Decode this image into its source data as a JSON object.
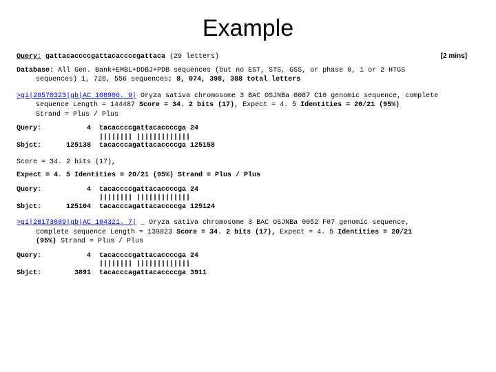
{
  "title": "Example",
  "query": {
    "label": "Query:",
    "seq": "gattacaccccgattacaccccgattaca",
    "len": "(29 letters)",
    "mins": "[2 mins]"
  },
  "database": {
    "label": "Database:",
    "line1": "All Gen. Bank+EMBL+DDBJ+PDB sequences (but no EST, STS, GSS, or phase 0, 1 or 2 HTGS",
    "line2": "sequences) 1, 726, 556 sequences;",
    "total": "8, 074, 398, 388 total letters"
  },
  "hit1": {
    "link": ">gi|28570323|gb|AC 108906. 9|",
    "desc1": "Oryza sativa chromosome 3 BAC OSJNBa 0087 C10 genomic sequence, complete",
    "desc2": "sequence Length = 144487",
    "score": "Score = 34. 2 bits (17),",
    "expect": "Expect = 4. 5",
    "ident": "Identities = 20/21 (95%)",
    "strand": "Strand = Plus / Plus"
  },
  "aln1": {
    "q": "Query:           4  tacaccccgattacaccccga 24",
    "m": "                    |||||||| |||||||||||||",
    "s": "Sbjct:      125138  tacacccagattacaccccga 125158"
  },
  "mid": {
    "score": "Score = 34. 2 bits (17),",
    "line": "Expect = 4. 5 Identities = 20/21 (95%) Strand = Plus / Plus"
  },
  "aln2": {
    "q": "Query:           4  tacaccccgattacaccccga 24",
    "m": "                    |||||||| |||||||||||||",
    "s": "Sbjct:      125104  tacacccagattacaccccga 125124"
  },
  "hit2": {
    "link": ">gi|28173089|gb|AC 104321. 7|",
    "desc1": "_ Oryza sativa chromosome 3 BAC OSJNBa 0052 F07 genomic sequence,",
    "desc2": "complete sequence Length = 139823",
    "score": "Score = 34. 2 bits (17),",
    "expect": "Expect = 4. 5",
    "ident": "Identities = 20/21",
    "ident2": "(95%)",
    "strand": "Strand = Plus / Plus"
  },
  "aln3": {
    "q": "Query:           4  tacaccccgattacaccccga 24",
    "m": "                    |||||||| |||||||||||||",
    "s": "Sbjct:        3891  tacacccagattacaccccga 3911"
  }
}
